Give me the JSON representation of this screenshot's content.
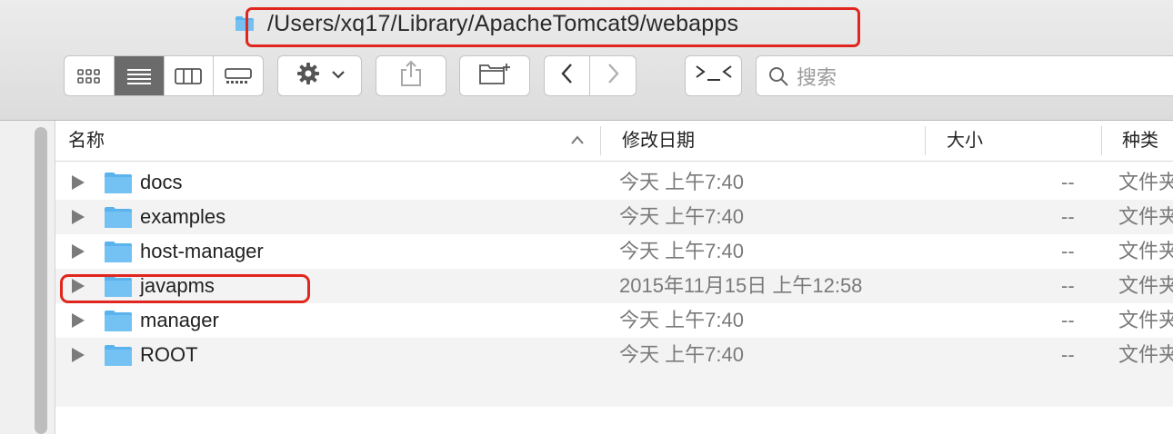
{
  "window": {
    "path": "/Users/xq17/Library/ApacheTomcat9/webapps",
    "path_icon": "folder-icon"
  },
  "toolbar": {
    "view_modes": [
      "icon-view-icon",
      "list-view-icon",
      "column-view-icon",
      "gallery-view-icon"
    ],
    "active_view": "list",
    "action_icon": "gear-icon",
    "share_icon": "share-icon",
    "new_folder_icon": "new-folder-icon",
    "back_icon": "chevron-left-icon",
    "forward_icon": "chevron-right-icon",
    "terminal_icon": "terminal-icon",
    "search_placeholder": "搜索"
  },
  "columns": {
    "name": "名称",
    "date": "修改日期",
    "size": "大小",
    "kind": "种类"
  },
  "rows": [
    {
      "name": "docs",
      "date": "今天 上午7:40",
      "size": "--",
      "kind": "文件夹"
    },
    {
      "name": "examples",
      "date": "今天 上午7:40",
      "size": "--",
      "kind": "文件夹"
    },
    {
      "name": "host-manager",
      "date": "今天 上午7:40",
      "size": "--",
      "kind": "文件夹"
    },
    {
      "name": "javapms",
      "date": "2015年11月15日 上午12:58",
      "size": "--",
      "kind": "文件夹"
    },
    {
      "name": "manager",
      "date": "今天 上午7:40",
      "size": "--",
      "kind": "文件夹"
    },
    {
      "name": "ROOT",
      "date": "今天 上午7:40",
      "size": "--",
      "kind": "文件夹"
    }
  ],
  "colors": {
    "annotation": "#e0261e",
    "folder": "#5bb3ee"
  }
}
